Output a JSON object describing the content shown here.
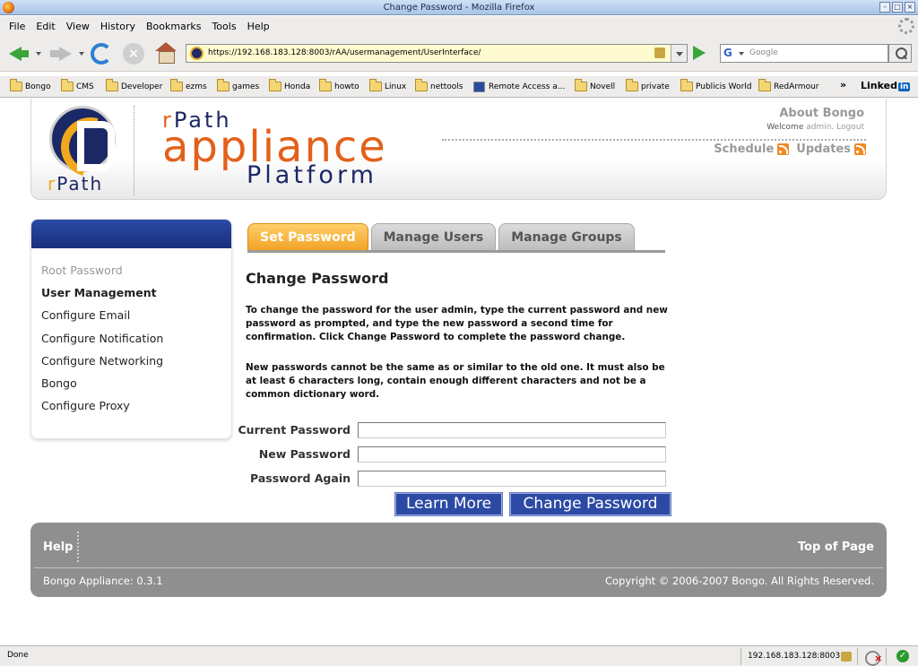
{
  "window": {
    "title": "Change Password - Mozilla Firefox"
  },
  "menu": [
    "File",
    "Edit",
    "View",
    "History",
    "Bookmarks",
    "Tools",
    "Help"
  ],
  "url": "https://192.168.183.128:8003/rAA/usermanagement/UserInterface/",
  "search": {
    "placeholder": "Google"
  },
  "bookmarks": [
    {
      "label": "Bongo",
      "icon": "folder-icon"
    },
    {
      "label": "CMS",
      "icon": "folder-icon"
    },
    {
      "label": "Developer",
      "icon": "folder-icon"
    },
    {
      "label": "ezms",
      "icon": "folder-icon"
    },
    {
      "label": "games",
      "icon": "folder-icon"
    },
    {
      "label": "Honda",
      "icon": "folder-icon"
    },
    {
      "label": "howto",
      "icon": "folder-icon"
    },
    {
      "label": "Linux",
      "icon": "folder-icon"
    },
    {
      "label": "nettools",
      "icon": "folder-icon"
    },
    {
      "label": "Remote Access a...",
      "icon": "page-icon"
    },
    {
      "label": "Novell",
      "icon": "folder-icon"
    },
    {
      "label": "private",
      "icon": "folder-icon"
    },
    {
      "label": "Publicis World",
      "icon": "folder-icon"
    },
    {
      "label": "RedArmour",
      "icon": "folder-icon"
    }
  ],
  "bookmarks_overflow": "»",
  "linkedin": {
    "text": "Linked",
    "badge": "in"
  },
  "header": {
    "logo_r": "r",
    "logo_path": "Path",
    "brand_r": "r",
    "brand_path": "Path",
    "brand_appliance": "appliance",
    "brand_platform": "Platform",
    "about": "About Bongo",
    "welcome_prefix": "Welcome",
    "user": "admin.",
    "logout": "Logout",
    "schedule": "Schedule",
    "updates": "Updates"
  },
  "sidebar": {
    "items": [
      {
        "label": "Root Password",
        "state": "disabled"
      },
      {
        "label": "User Management",
        "state": "active"
      },
      {
        "label": "Configure Email",
        "state": "normal"
      },
      {
        "label": "Configure Notification",
        "state": "normal"
      },
      {
        "label": "Configure Networking",
        "state": "normal"
      },
      {
        "label": "Bongo",
        "state": "normal"
      },
      {
        "label": "Configure Proxy",
        "state": "normal"
      }
    ]
  },
  "tabs": [
    {
      "label": "Set Password",
      "active": true
    },
    {
      "label": "Manage Users",
      "active": false
    },
    {
      "label": "Manage Groups",
      "active": false
    }
  ],
  "main": {
    "title": "Change Password",
    "para1": "To change the password for the user admin, type the current password and new password as prompted, and type the new password a second time for confirmation. Click Change Password to complete the password change.",
    "para2": "New passwords cannot be the same as or similar to the old one. It must also be at least 6 characters long, contain enough different characters and not be a common dictionary word.",
    "fields": {
      "current_label": "Current Password",
      "new_label": "New Password",
      "again_label": "Password Again",
      "current_value": "",
      "new_value": "",
      "again_value": ""
    },
    "learn_more": "Learn More",
    "change_password": "Change Password"
  },
  "footer": {
    "help": "Help",
    "top_of_page": "Top of Page",
    "version": "Bongo Appliance: 0.3.1",
    "copyright": "Copyright © 2006-2007 Bongo. All Rights Reserved."
  },
  "status": {
    "text": "Done",
    "host": "192.168.183.128:8003"
  }
}
